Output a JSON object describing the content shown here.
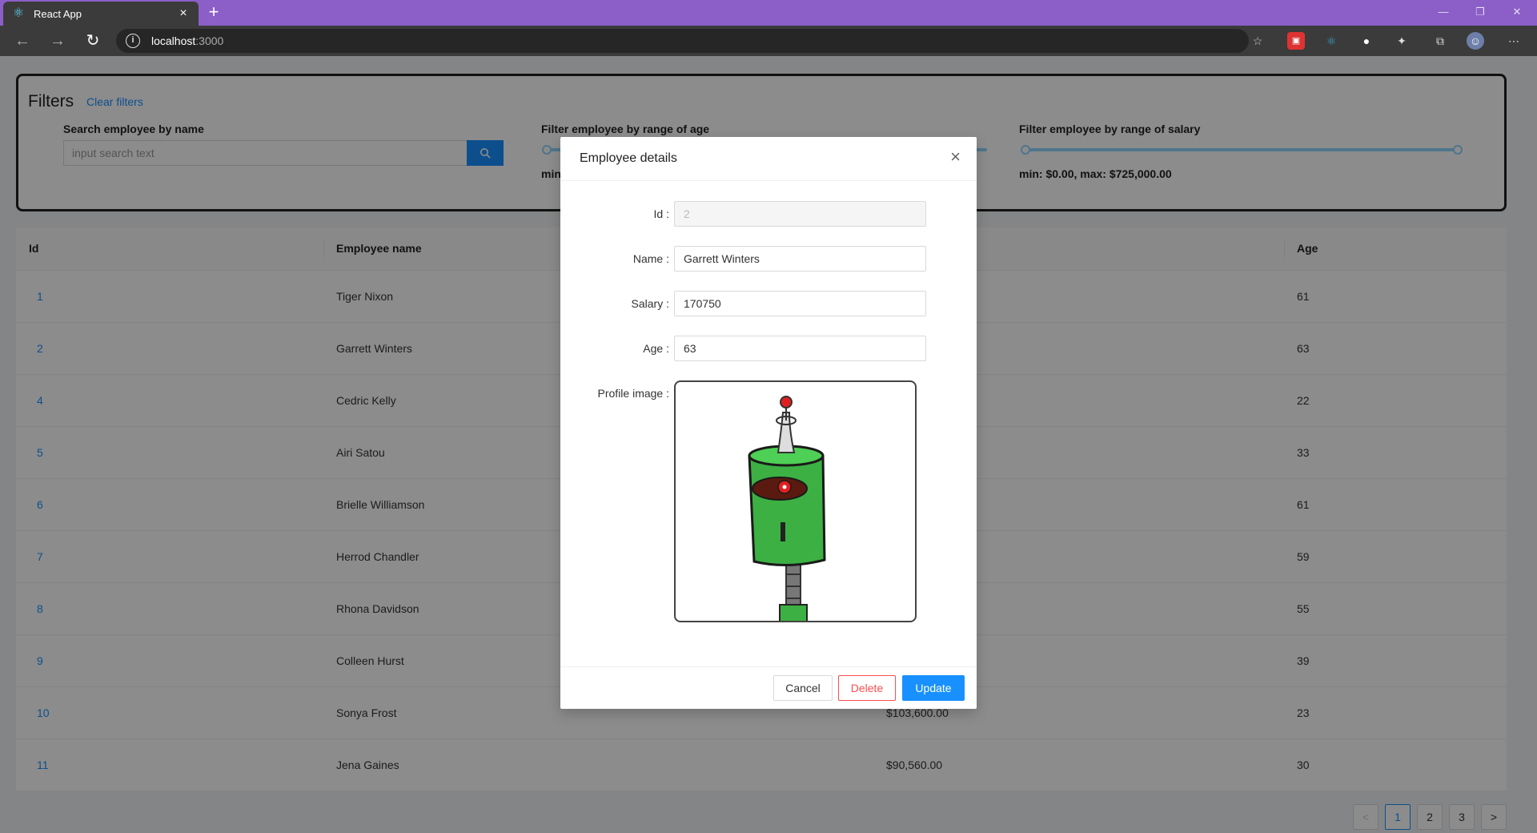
{
  "browser": {
    "tab_title": "React App",
    "tab_close": "×",
    "new_tab": "+",
    "url_host": "localhost",
    "url_port": ":3000"
  },
  "filters": {
    "title": "Filters",
    "clear_label": "Clear filters",
    "name_label": "Search employee by name",
    "search_placeholder": "input search text",
    "age_label": "Filter employee by range of age",
    "age_range_text": "min",
    "salary_label": "Filter employee by range of salary",
    "salary_range_text": "min: $0.00, max: $725,000.00"
  },
  "table": {
    "columns": {
      "id": "Id",
      "name": "Employee name",
      "age": "Age"
    },
    "rows": [
      {
        "id": "1",
        "name": "Tiger Nixon",
        "salary": "",
        "age": "61"
      },
      {
        "id": "2",
        "name": "Garrett Winters",
        "salary": "",
        "age": "63"
      },
      {
        "id": "4",
        "name": "Cedric Kelly",
        "salary": "",
        "age": "22"
      },
      {
        "id": "5",
        "name": "Airi Satou",
        "salary": "",
        "age": "33"
      },
      {
        "id": "6",
        "name": "Brielle Williamson",
        "salary": "",
        "age": "61"
      },
      {
        "id": "7",
        "name": "Herrod Chandler",
        "salary": "",
        "age": "59"
      },
      {
        "id": "8",
        "name": "Rhona Davidson",
        "salary": "",
        "age": "55"
      },
      {
        "id": "9",
        "name": "Colleen Hurst",
        "salary": "",
        "age": "39"
      },
      {
        "id": "10",
        "name": "Sonya Frost",
        "salary": "$103,600.00",
        "age": "23"
      },
      {
        "id": "11",
        "name": "Jena Gaines",
        "salary": "$90,560.00",
        "age": "30"
      }
    ]
  },
  "pagination": {
    "prev": "<",
    "pages": [
      "1",
      "2",
      "3"
    ],
    "next": ">",
    "current": "1"
  },
  "modal": {
    "title": "Employee details",
    "close": "×",
    "id_label": "Id",
    "id_value": "2",
    "name_label": "Name",
    "name_value": "Garrett Winters",
    "salary_label": "Salary",
    "salary_value": "170750",
    "age_label": "Age",
    "age_value": "63",
    "profile_label": "Profile image",
    "cancel": "Cancel",
    "delete": "Delete",
    "update": "Update"
  },
  "colors": {
    "accent": "#1890ff",
    "danger": "#ff4d4f",
    "tabbar": "#8b5fc7",
    "robot_body": "#3cb043",
    "robot_eye": "#e02020"
  }
}
